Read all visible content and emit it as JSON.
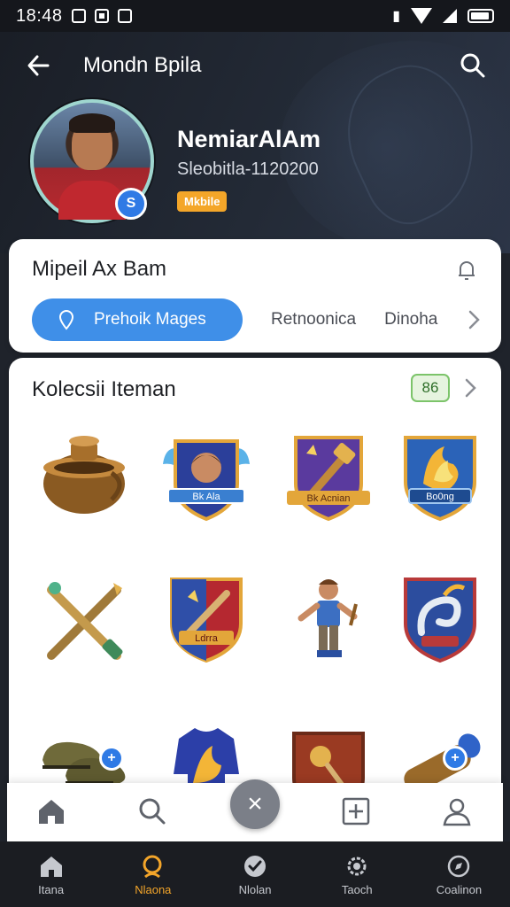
{
  "status_bar": {
    "time": "18:48"
  },
  "header": {
    "title": "Mondn Bpila"
  },
  "profile": {
    "name": "NemiarAlAm",
    "subtitle": "Sleobitla-1120200",
    "tag": "Mkbile"
  },
  "card_tabs": {
    "title": "Mipeil Ax Bam",
    "active_tab": "Prehoik Mages",
    "tabs": [
      "Retnoonica",
      "Dinoha"
    ]
  },
  "collection": {
    "title": "Kolecsii Iteman",
    "count": "86",
    "items": [
      {
        "name": "bronze-pot-icon"
      },
      {
        "name": "winged-hero-shield-icon",
        "label": "Bk Ala"
      },
      {
        "name": "purple-hammer-shield-icon",
        "label": "Bk Acnian"
      },
      {
        "name": "flame-shield-icon",
        "label": "Bo0ng"
      },
      {
        "name": "crossed-staffs-icon"
      },
      {
        "name": "red-sword-shield-icon",
        "label": "Ldrra"
      },
      {
        "name": "warrior-figure-icon"
      },
      {
        "name": "serpent-shield-icon"
      },
      {
        "name": "loafers-icon"
      },
      {
        "name": "blue-jersey-icon"
      },
      {
        "name": "torch-shield-icon"
      },
      {
        "name": "brass-scroll-icon"
      }
    ]
  },
  "bottom_nav": {
    "items": [
      {
        "label": "Itana",
        "icon": "home-icon"
      },
      {
        "label": "Nlaona",
        "icon": "search-icon",
        "active": true
      },
      {
        "label": "Nlolan",
        "icon": "check-icon"
      },
      {
        "label": "Taoch",
        "icon": "gear-icon"
      },
      {
        "label": "Coalinon",
        "icon": "compass-icon"
      }
    ]
  },
  "colors": {
    "accent": "#3f8fe8",
    "tag": "#f4a629",
    "nav_active": "#f3a52a"
  }
}
